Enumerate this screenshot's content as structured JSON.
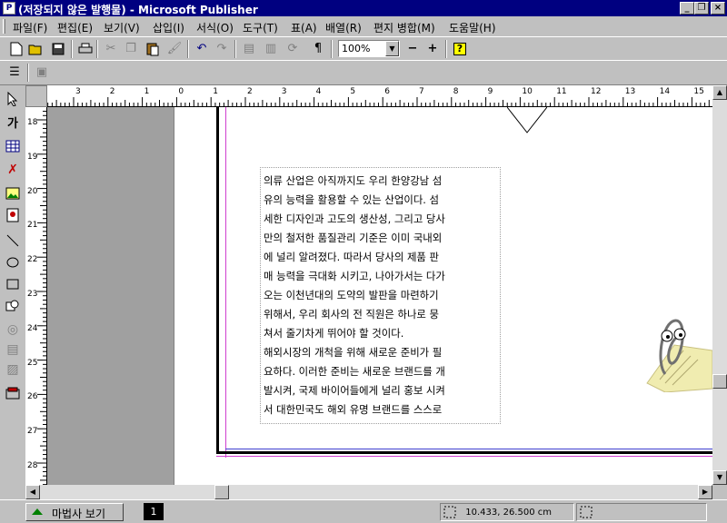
{
  "window": {
    "title": "(저장되지 않은 발행물) - Microsoft Publisher",
    "min_glyph": "_",
    "restore_glyph": "❐",
    "close_glyph": "×"
  },
  "menu": {
    "items": [
      {
        "label": "파일(F)"
      },
      {
        "label": "편집(E)"
      },
      {
        "label": "보기(V)"
      },
      {
        "label": "삽입(I)"
      },
      {
        "label": "서식(O)"
      },
      {
        "label": "도구(T)"
      },
      {
        "label": "표(A)"
      },
      {
        "label": "배열(R)"
      },
      {
        "label": "편지 병합(M)"
      },
      {
        "label": "도움말(H)"
      }
    ]
  },
  "toolbar": {
    "zoom": "100%",
    "zoom_out": "−",
    "zoom_in": "+",
    "help": "?"
  },
  "ruler": {
    "h_labels": [
      "3",
      "2",
      "1",
      "0",
      "1",
      "2",
      "3",
      "4",
      "5",
      "6",
      "7",
      "8",
      "9",
      "10",
      "11",
      "12",
      "13",
      "14",
      "15"
    ],
    "v_labels": [
      "18",
      "19",
      "20",
      "21",
      "22",
      "23",
      "24",
      "25",
      "26",
      "27",
      "28"
    ]
  },
  "document": {
    "lines": [
      "의류 산업은 아직까지도 우리 한양강남 섬",
      "유의 능력을 활용할 수 있는 산업이다. 섬",
      "세한 디자인과 고도의 생산성, 그리고 당사",
      "만의 철저한 품질관리 기준은 이미 국내외",
      "에 널리 알려졌다. 따라서 당사의 제품 판",
      "매 능력을 극대화 시키고, 나아가서는 다가",
      "오는 이천년대의 도약의 발판을 마련하기",
      "위해서, 우리 회사의 전 직원은 하나로 뭉",
      "쳐서 줄기차게 뛰어야 할 것이다.",
      "해외시장의 개척을 위해 새로운 준비가 필",
      "요하다. 이러한 준비는 새로운 브랜드를 개",
      "발시켜, 국제 바이어들에게 널리 홍보 시켜",
      "서 대한민국도 해외 유명 브랜드를 스스로"
    ]
  },
  "status": {
    "wizard_label": "마법사 보기",
    "page_number": "1",
    "coordinates": "10.433, 26.500 cm"
  }
}
